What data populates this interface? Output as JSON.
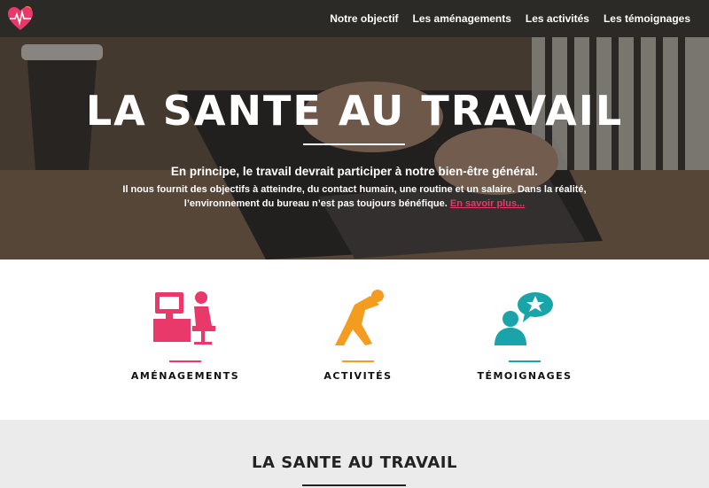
{
  "nav": {
    "links": [
      "Notre objectif",
      "Les aménagements",
      "Les activités",
      "Les témoignages"
    ]
  },
  "hero": {
    "title": "LA SANTE AU TRAVAIL",
    "lead": "En principe, le travail devrait participer à notre bien-être général.",
    "text": "Il nous fournit des objectifs à atteindre, du contact humain, une routine et un salaire. Dans la réalité, l’environnement du bureau n’est pas toujours bénéfique.",
    "link_label": "En savoir plus..."
  },
  "features": [
    {
      "label": "AMÉNAGEMENTS",
      "icon": "workstation-icon",
      "color": "#e8396a"
    },
    {
      "label": "ACTIVITÉS",
      "icon": "stretching-person-icon",
      "color": "#f39c1f"
    },
    {
      "label": "TÉMOIGNAGES",
      "icon": "speech-bubble-person-icon",
      "color": "#1aa3a8"
    }
  ],
  "section2": {
    "title": "LA SANTE AU TRAVAIL"
  },
  "colors": {
    "navbar": "#2b2a26",
    "accent_pink": "#e8396a",
    "accent_orange": "#f39c1f",
    "accent_teal": "#1aa3a8",
    "section_gray": "#ebebeb"
  }
}
